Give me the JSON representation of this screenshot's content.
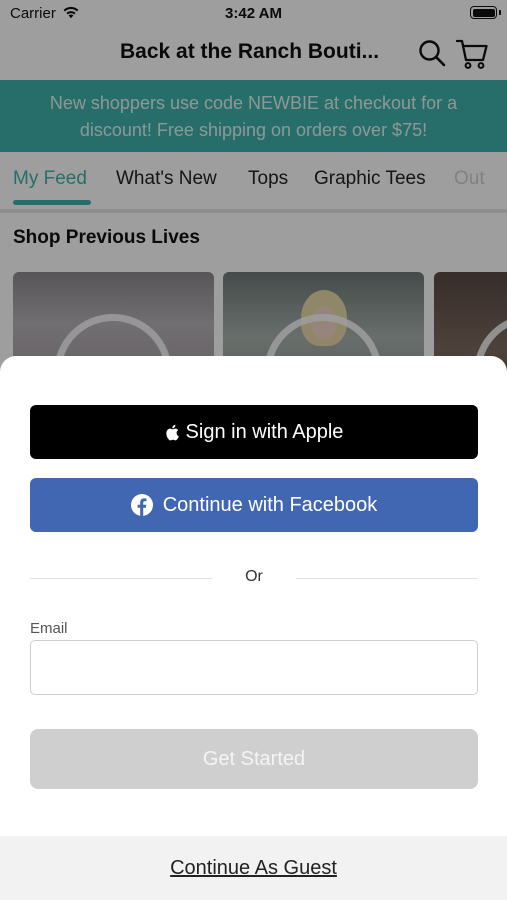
{
  "status_bar": {
    "carrier": "Carrier",
    "time": "3:42 AM"
  },
  "header": {
    "title": "Back at the Ranch Bouti...",
    "search_icon": "search-icon",
    "cart_icon": "cart-icon"
  },
  "banner": {
    "text": "New shoppers use code NEWBIE at checkout for a discount! Free shipping on orders over $75!"
  },
  "tabs": [
    {
      "label": "My Feed",
      "active": true
    },
    {
      "label": "What's New"
    },
    {
      "label": "Tops"
    },
    {
      "label": "Graphic Tees"
    },
    {
      "label": "Out"
    }
  ],
  "section": {
    "title": "Shop Previous Lives"
  },
  "colors": {
    "accent": "#3fb2ab",
    "facebook": "#4267b2",
    "apple": "#000000",
    "disabled_button": "#cfcfcf"
  },
  "sheet": {
    "apple_label": "Sign in with Apple",
    "facebook_label": "Continue with Facebook",
    "or_label": "Or",
    "email_label": "Email",
    "email_value": "",
    "email_placeholder": "",
    "get_started_label": "Get Started",
    "guest_label": "Continue As Guest"
  }
}
